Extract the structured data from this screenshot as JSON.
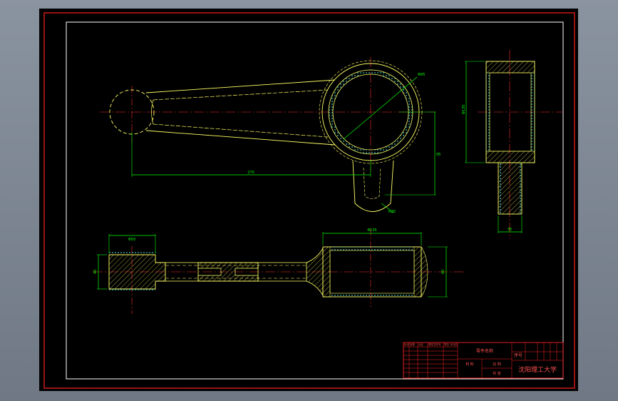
{
  "colors": {
    "viewport_bg": "#7d8590",
    "sheet_bg": "#000000",
    "frame": "#ff2020",
    "border": "#ffffff",
    "outline": "#ffff66",
    "center_line": "#ff3030",
    "dimension": "#00ff00",
    "hatch": "#c8c850",
    "bushing": "#40c0c0"
  },
  "drawing": {
    "part_name": "连杆",
    "dims": {
      "center_distance": "270",
      "bore_diameter": "Φ95",
      "lower_offset": "95",
      "boss_radius": "R20",
      "side_view_height": "Φ135",
      "side_view_shank": "35",
      "bottom_view_width": "Φ135",
      "bottom_view_small_end": "Φ50",
      "bottom_view_height": "60",
      "bottom_view_small_height": "40"
    }
  },
  "title_block": {
    "part_name_label": "零件名称",
    "material_label": "材 料",
    "scale_label": "比 例",
    "sheet_label": "共 张",
    "drawing_no_label": "序号",
    "school": "沈阳理工大学",
    "rev_cells": [
      "标记",
      "处数",
      "分区",
      "更改文件号",
      "签名",
      "年月日"
    ]
  }
}
